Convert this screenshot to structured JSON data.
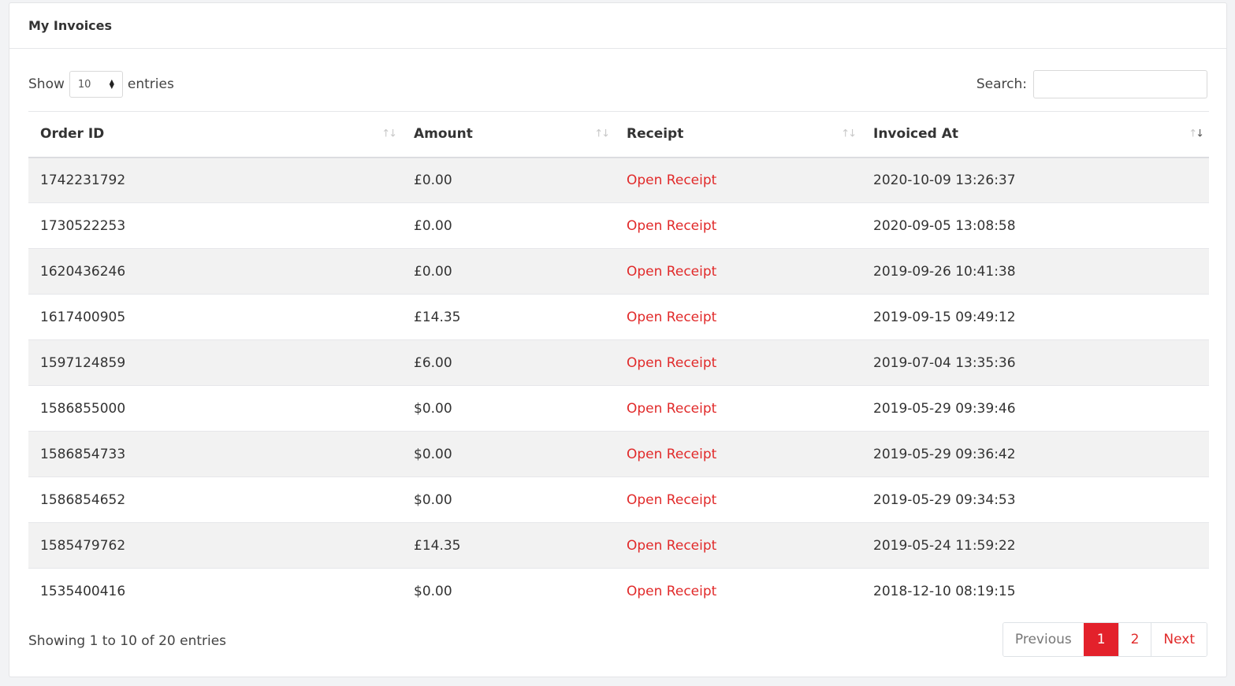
{
  "card": {
    "title": "My Invoices"
  },
  "length": {
    "show_label": "Show",
    "selected": "10",
    "entries_label": "entries"
  },
  "search": {
    "label": "Search:",
    "value": "",
    "placeholder": ""
  },
  "table": {
    "columns": [
      "Order ID",
      "Amount",
      "Receipt",
      "Invoiced At"
    ],
    "sorted_column": "Invoiced At",
    "rows": [
      {
        "order_id": "1742231792",
        "amount": "£0.00",
        "receipt": "Open Receipt",
        "invoiced_at": "2020-10-09 13:26:37"
      },
      {
        "order_id": "1730522253",
        "amount": "£0.00",
        "receipt": "Open Receipt",
        "invoiced_at": "2020-09-05 13:08:58"
      },
      {
        "order_id": "1620436246",
        "amount": "£0.00",
        "receipt": "Open Receipt",
        "invoiced_at": "2019-09-26 10:41:38"
      },
      {
        "order_id": "1617400905",
        "amount": "£14.35",
        "receipt": "Open Receipt",
        "invoiced_at": "2019-09-15 09:49:12"
      },
      {
        "order_id": "1597124859",
        "amount": "£6.00",
        "receipt": "Open Receipt",
        "invoiced_at": "2019-07-04 13:35:36"
      },
      {
        "order_id": "1586855000",
        "amount": "$0.00",
        "receipt": "Open Receipt",
        "invoiced_at": "2019-05-29 09:39:46"
      },
      {
        "order_id": "1586854733",
        "amount": "$0.00",
        "receipt": "Open Receipt",
        "invoiced_at": "2019-05-29 09:36:42"
      },
      {
        "order_id": "1586854652",
        "amount": "$0.00",
        "receipt": "Open Receipt",
        "invoiced_at": "2019-05-29 09:34:53"
      },
      {
        "order_id": "1585479762",
        "amount": "£14.35",
        "receipt": "Open Receipt",
        "invoiced_at": "2019-05-24 11:59:22"
      },
      {
        "order_id": "1535400416",
        "amount": "$0.00",
        "receipt": "Open Receipt",
        "invoiced_at": "2018-12-10 08:19:15"
      }
    ]
  },
  "footer": {
    "info": "Showing 1 to 10 of 20 entries"
  },
  "pagination": {
    "previous": "Previous",
    "pages": [
      "1",
      "2"
    ],
    "current": "1",
    "next": "Next"
  },
  "colors": {
    "accent": "#e3212b",
    "link": "#e12a2a",
    "stripe": "#f2f2f2"
  }
}
